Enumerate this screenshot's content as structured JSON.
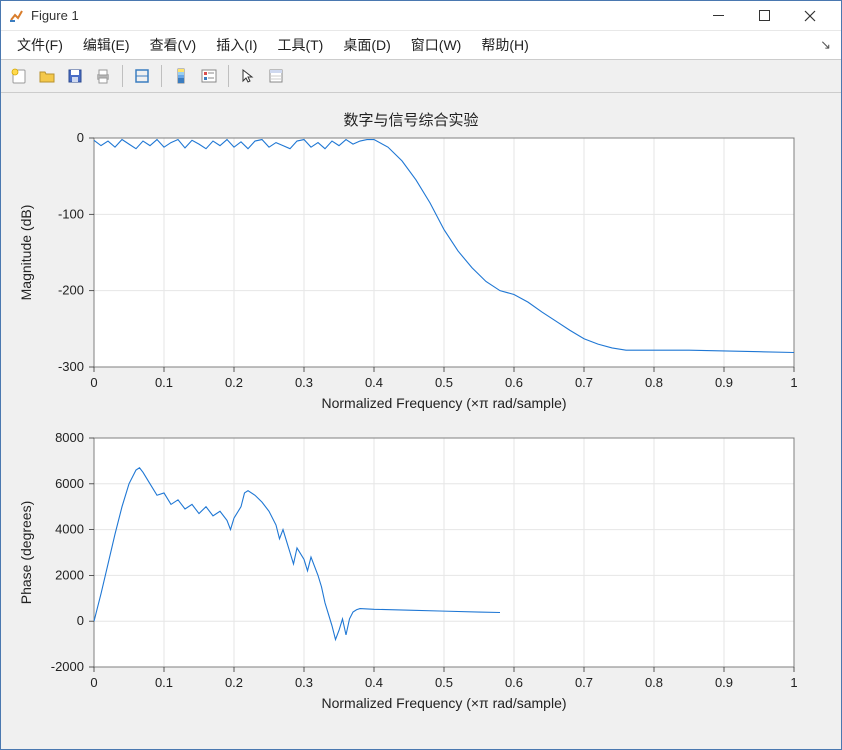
{
  "window": {
    "title": "Figure 1"
  },
  "menu": {
    "file": "文件(F)",
    "edit": "编辑(E)",
    "view": "查看(V)",
    "insert": "插入(I)",
    "tools": "工具(T)",
    "desktop": "桌面(D)",
    "window": "窗口(W)",
    "help": "帮助(H)"
  },
  "chart_data": [
    {
      "type": "line",
      "title": "数字与信号综合实验",
      "xlabel": "Normalized Frequency  (×π rad/sample)",
      "ylabel": "Magnitude (dB)",
      "xlim": [
        0,
        1
      ],
      "ylim": [
        -300,
        0
      ],
      "xticks": [
        0,
        0.1,
        0.2,
        0.3,
        0.4,
        0.5,
        0.6,
        0.7,
        0.8,
        0.9,
        1
      ],
      "yticks": [
        -300,
        -200,
        -100,
        0
      ],
      "series": [
        {
          "name": "magnitude",
          "x": [
            0.0,
            0.01,
            0.02,
            0.03,
            0.04,
            0.05,
            0.06,
            0.07,
            0.08,
            0.09,
            0.1,
            0.11,
            0.12,
            0.13,
            0.14,
            0.15,
            0.16,
            0.17,
            0.18,
            0.19,
            0.2,
            0.21,
            0.22,
            0.23,
            0.24,
            0.25,
            0.26,
            0.27,
            0.28,
            0.29,
            0.3,
            0.31,
            0.32,
            0.33,
            0.34,
            0.35,
            0.36,
            0.37,
            0.38,
            0.39,
            0.4,
            0.42,
            0.44,
            0.46,
            0.48,
            0.5,
            0.52,
            0.54,
            0.56,
            0.58,
            0.6,
            0.62,
            0.64,
            0.66,
            0.68,
            0.7,
            0.72,
            0.74,
            0.76,
            0.78,
            0.8,
            0.85,
            0.9,
            0.95,
            1.0
          ],
          "y": [
            -3,
            -10,
            -4,
            -12,
            -2,
            -8,
            -14,
            -4,
            -10,
            -2,
            -12,
            -6,
            -2,
            -13,
            -3,
            -8,
            -14,
            -4,
            -10,
            -2,
            -12,
            -5,
            -14,
            -4,
            -2,
            -12,
            -6,
            -10,
            -14,
            -4,
            -2,
            -12,
            -6,
            -14,
            -4,
            -10,
            -2,
            -8,
            -4,
            -2,
            -2,
            -12,
            -30,
            -55,
            -85,
            -120,
            -148,
            -170,
            -188,
            -200,
            -205,
            -215,
            -228,
            -240,
            -252,
            -263,
            -270,
            -275,
            -278,
            -278,
            -278,
            -278,
            -279,
            -280,
            -281
          ]
        }
      ]
    },
    {
      "type": "line",
      "xlabel": "Normalized Frequency  (×π rad/sample)",
      "ylabel": "Phase (degrees)",
      "xlim": [
        0,
        1
      ],
      "ylim": [
        -2000,
        8000
      ],
      "xticks": [
        0,
        0.1,
        0.2,
        0.3,
        0.4,
        0.5,
        0.6,
        0.7,
        0.8,
        0.9,
        1
      ],
      "yticks": [
        -2000,
        0,
        2000,
        4000,
        6000,
        8000
      ],
      "series": [
        {
          "name": "phase",
          "x": [
            0.0,
            0.01,
            0.02,
            0.03,
            0.04,
            0.05,
            0.06,
            0.065,
            0.07,
            0.08,
            0.09,
            0.1,
            0.11,
            0.12,
            0.13,
            0.14,
            0.15,
            0.16,
            0.17,
            0.18,
            0.19,
            0.195,
            0.2,
            0.21,
            0.215,
            0.22,
            0.23,
            0.24,
            0.25,
            0.26,
            0.265,
            0.27,
            0.275,
            0.28,
            0.285,
            0.29,
            0.3,
            0.305,
            0.31,
            0.32,
            0.325,
            0.33,
            0.335,
            0.34,
            0.345,
            0.35,
            0.355,
            0.36,
            0.365,
            0.37,
            0.375,
            0.38,
            0.4,
            0.45,
            0.5,
            0.55,
            0.58
          ],
          "y": [
            0,
            1200,
            2500,
            3800,
            5000,
            6000,
            6600,
            6700,
            6500,
            6000,
            5500,
            5600,
            5100,
            5300,
            4900,
            5100,
            4700,
            5000,
            4600,
            4800,
            4400,
            4000,
            4500,
            5000,
            5600,
            5700,
            5500,
            5200,
            4800,
            4200,
            3600,
            4000,
            3500,
            3000,
            2500,
            3200,
            2700,
            2200,
            2800,
            2000,
            1500,
            800,
            300,
            -200,
            -800,
            -400,
            100,
            -600,
            100,
            400,
            500,
            550,
            520,
            480,
            440,
            400,
            380
          ]
        }
      ]
    }
  ]
}
